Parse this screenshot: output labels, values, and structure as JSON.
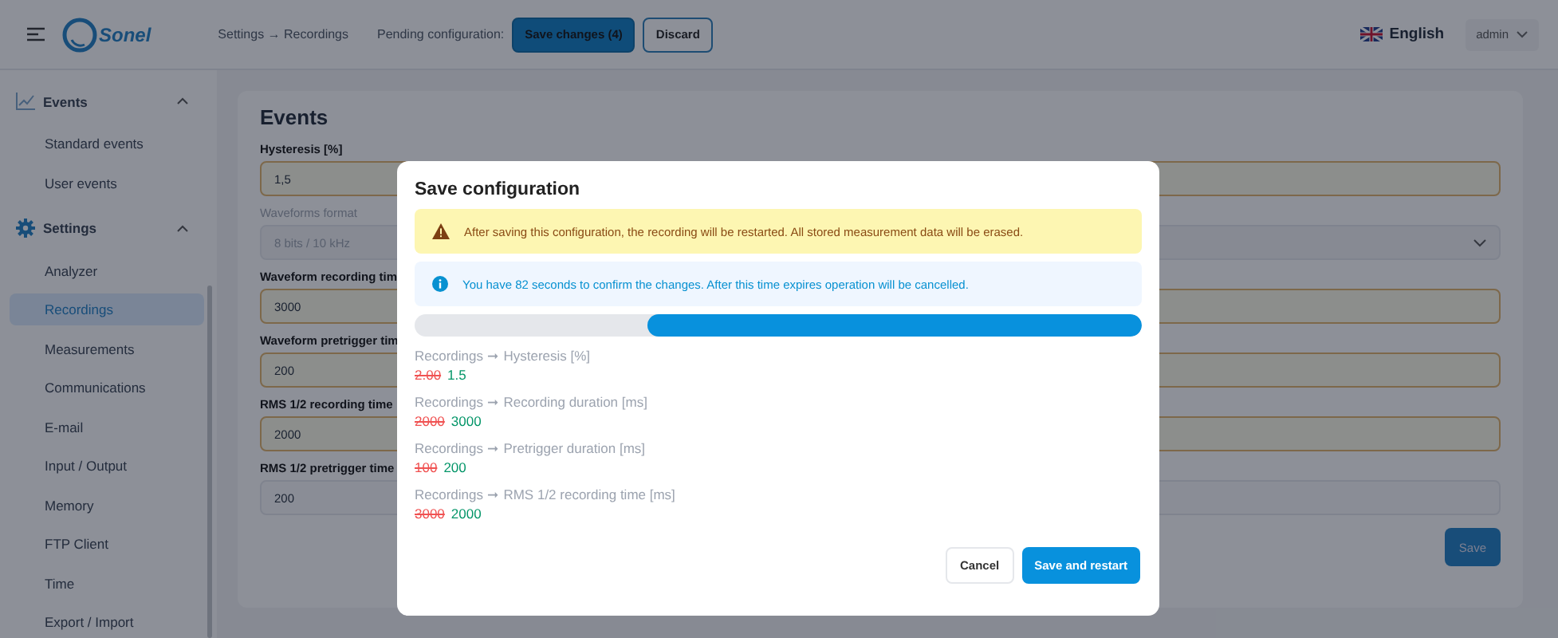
{
  "header": {
    "logo_text": "Sonel",
    "breadcrumb": "Settings → Recordings",
    "pending_label": "Pending configuration:",
    "save_button": "Save changes (4)",
    "discard_button": "Discard",
    "language": "English",
    "user": "admin"
  },
  "sidebar": {
    "groups": [
      {
        "label": "Events",
        "expanded": true,
        "items": [
          {
            "label": "Standard events",
            "selected": false
          },
          {
            "label": "User events",
            "selected": false
          }
        ]
      },
      {
        "label": "Settings",
        "expanded": true,
        "items": [
          {
            "label": "Analyzer",
            "selected": false
          },
          {
            "label": "Recordings",
            "selected": true
          },
          {
            "label": "Measurements",
            "selected": false
          },
          {
            "label": "Communications",
            "selected": false
          },
          {
            "label": "E-mail",
            "selected": false
          },
          {
            "label": "Input / Output",
            "selected": false
          },
          {
            "label": "Memory",
            "selected": false
          },
          {
            "label": "FTP Client",
            "selected": false
          },
          {
            "label": "Time",
            "selected": false
          },
          {
            "label": "Export / Import",
            "selected": false
          }
        ]
      }
    ]
  },
  "form": {
    "title": "Events",
    "fields": [
      {
        "label": "Hysteresis [%]",
        "kind": "input",
        "value": "1,5",
        "modified": true,
        "disabled": false
      },
      {
        "label": "Waveforms format",
        "kind": "select",
        "value": "8 bits / 10 kHz",
        "modified": false,
        "disabled": true
      },
      {
        "label": "Waveform recording tim",
        "kind": "input",
        "value": "3000",
        "modified": true,
        "disabled": false
      },
      {
        "label": "Waveform pretrigger tim",
        "kind": "input",
        "value": "200",
        "modified": true,
        "disabled": false
      },
      {
        "label": "RMS 1/2 recording time",
        "kind": "input",
        "value": "2000",
        "modified": true,
        "disabled": false
      },
      {
        "label": "RMS 1/2 pretrigger time",
        "kind": "input",
        "value": "200",
        "modified": false,
        "disabled": false
      }
    ],
    "save_button": "Save"
  },
  "dialog": {
    "title": "Save configuration",
    "warning": "After saving this configuration, the recording will be restarted. All stored measurement data will be erased.",
    "info": "You have 82 seconds to confirm the changes. After this time expires operation will be cancelled.",
    "countdown": {
      "level": 0.68
    },
    "changes": [
      {
        "path": "Recordings ➞ Hysteresis [%]",
        "old": "2.00",
        "new": "1.5"
      },
      {
        "path": "Recordings ➞ Recording duration [ms]",
        "old": "2000",
        "new": "3000"
      },
      {
        "path": "Recordings ➞ Pretrigger duration [ms]",
        "old": "100",
        "new": "200"
      },
      {
        "path": "Recordings ➞ RMS 1/2 recording time [ms]",
        "old": "3000",
        "new": "2000"
      }
    ],
    "cancel_button": "Cancel",
    "confirm_button": "Save and restart"
  }
}
